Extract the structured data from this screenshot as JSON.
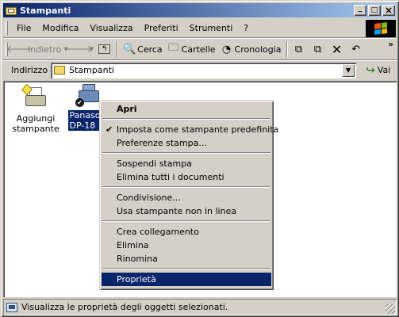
{
  "window": {
    "title": "Stampanti",
    "buttons": {
      "minimize": "_",
      "maximize": "□",
      "close": "×"
    }
  },
  "menubar": {
    "items": [
      "File",
      "Modifica",
      "Visualizza",
      "Preferiti",
      "Strumenti",
      "?"
    ]
  },
  "toolbar": {
    "back": "Indietro",
    "search": "Cerca",
    "folders": "Cartelle",
    "history": "Cronologia"
  },
  "address": {
    "label": "Indirizzo",
    "value": "Stampanti",
    "go": "Vai"
  },
  "items": [
    {
      "label_line1": "Aggiungi",
      "label_line2": "stampante",
      "icon": "add-printer-icon",
      "selected": false
    },
    {
      "label_line1": "Panaso",
      "label_line2": "DP-18",
      "icon": "network-printer-icon",
      "selected": true
    }
  ],
  "context_menu": {
    "open": "Apri",
    "set_default": "Imposta come stampante predefinita",
    "prefs": "Preferenze stampa...",
    "pause": "Sospendi stampa",
    "cancel_all": "Elimina tutti i documenti",
    "sharing": "Condivisione...",
    "offline": "Usa stampante non in linea",
    "shortcut": "Crea collegamento",
    "delete": "Elimina",
    "rename": "Rinomina",
    "properties": "Proprietà",
    "checked_item": "Imposta come stampante predefinita",
    "highlighted_item": "Proprietà"
  },
  "statusbar": {
    "text": "Visualizza le proprietà degli oggetti selezionati."
  },
  "colors": {
    "titlebar_start": "#0a246a",
    "titlebar_end": "#a6caf0",
    "selection": "#0a246a",
    "face": "#d4d0c8"
  }
}
